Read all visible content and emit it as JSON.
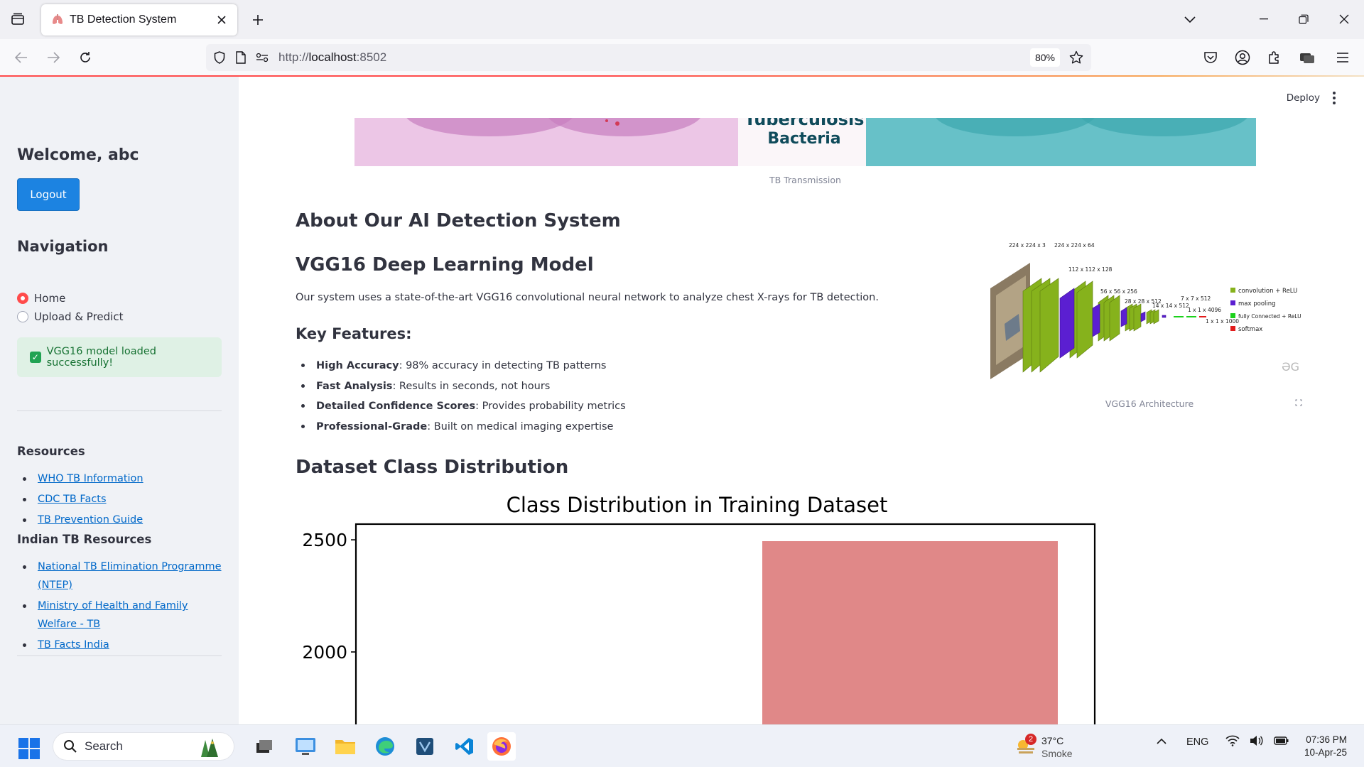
{
  "browser": {
    "tab_title": "TB Detection System",
    "url_prefix": "http://",
    "url_host": "localhost",
    "url_port": ":8502",
    "zoom": "80%"
  },
  "app": {
    "deploy_label": "Deploy"
  },
  "sidebar": {
    "welcome": "Welcome, abc",
    "logout_label": "Logout",
    "nav_title": "Navigation",
    "nav_options": [
      {
        "label": "Home",
        "selected": true
      },
      {
        "label": "Upload & Predict",
        "selected": false
      }
    ],
    "status_message": "VGG16 model loaded successfully!",
    "resources_title": "Resources",
    "resources": [
      "WHO TB Information",
      "CDC TB Facts",
      "TB Prevention Guide"
    ],
    "indian_title": "Indian TB Resources",
    "indian_resources": [
      "National TB Elimination Programme (NTEP)",
      "Ministry of Health and Family Welfare - TB",
      "TB Facts India"
    ]
  },
  "main": {
    "hero_text_line1": "Tuberculosis",
    "hero_text_line2": "Bacteria",
    "hero_caption": "TB Transmission",
    "about_title": "About Our AI Detection System",
    "model_title": "VGG16 Deep Learning Model",
    "model_description": "Our system uses a state-of-the-art VGG16 convolutional neural network to analyze chest X-rays for TB detection.",
    "features_title": "Key Features:",
    "features": [
      {
        "name": "High Accuracy",
        "text": ": 98% accuracy in detecting TB patterns"
      },
      {
        "name": "Fast Analysis",
        "text": ": Results in seconds, not hours"
      },
      {
        "name": "Detailed Confidence Scores",
        "text": ": Provides probability metrics"
      },
      {
        "name": "Professional-Grade",
        "text": ": Built on medical imaging expertise"
      }
    ],
    "vgg_caption": "VGG16 Architecture",
    "vgg_labels": {
      "l1": "224 x 224 x 3",
      "l2": "224 x 224 x 64",
      "l3": "112 x 112 x 128",
      "l4": "56 x 56 x 256",
      "l5": "28 x 28 x 512",
      "l6": "14 x 14 x 512",
      "l7": "7 x 7 x 512",
      "l8": "1 x 1 x 4096",
      "l9": "1 x 1 x 1000",
      "legend_conv": "convolution + ReLU",
      "legend_pool": "max pooling",
      "legend_fc": "fully Connected + ReLU",
      "legend_softmax": "softmax",
      "watermark": "ƏG"
    },
    "dataset_title": "Dataset Class Distribution"
  },
  "chart_data": {
    "type": "bar",
    "title": "Class Distribution in Training Dataset",
    "xlabel": "",
    "ylabel": "",
    "series": [
      {
        "values": [
          2494
        ],
        "color": "#e08888"
      }
    ],
    "yticks": [
      2000,
      2500
    ],
    "ylim_visible": [
      1620,
      2570
    ]
  },
  "taskbar": {
    "search_placeholder": "Search",
    "weather_badge": "2",
    "weather_temp": "37°C",
    "weather_cond": "Smoke",
    "language": "ENG",
    "time": "07:36 PM",
    "date": "10-Apr-25"
  },
  "colors": {
    "accent": "#ff4b4b",
    "button": "#1c83e1",
    "link": "#0068c9",
    "success_bg": "#dff1e5",
    "success_text": "#177233"
  }
}
